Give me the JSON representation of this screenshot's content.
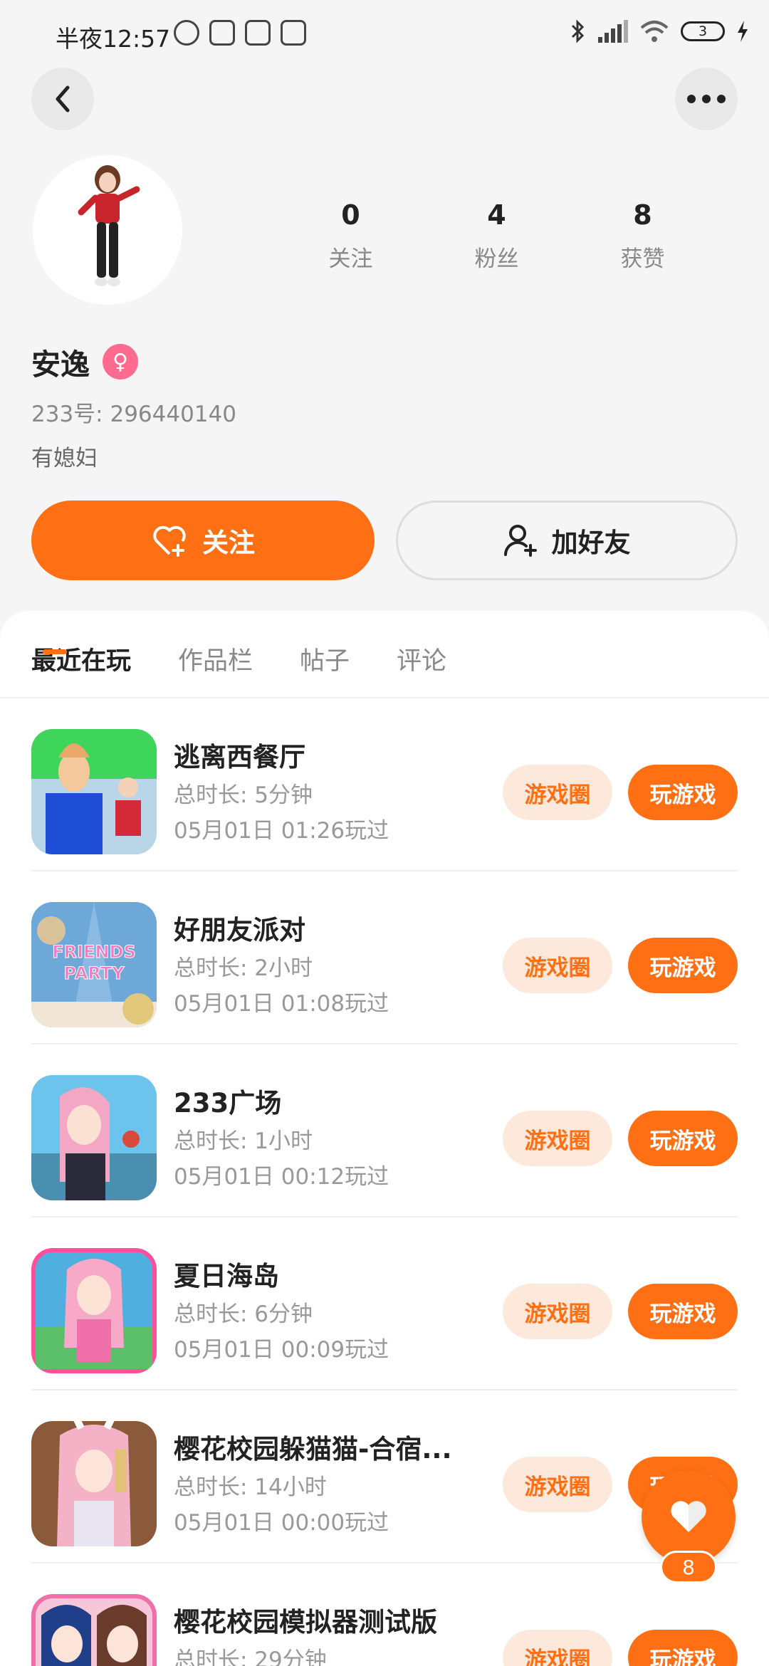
{
  "status_bar": {
    "time": "半夜12:57",
    "battery": "3"
  },
  "profile": {
    "stats": [
      {
        "value": "0",
        "label": "关注"
      },
      {
        "value": "4",
        "label": "粉丝"
      },
      {
        "value": "8",
        "label": "获赞"
      }
    ],
    "name": "安逸",
    "gender_symbol": "♀",
    "uid": "233号: 296440140",
    "bio": "有媳妇",
    "follow_label": "关注",
    "add_friend_label": "加好友"
  },
  "tabs": [
    "最近在玩",
    "作品栏",
    "帖子",
    "评论"
  ],
  "actions": {
    "circle_label": "游戏圈",
    "play_label": "玩游戏"
  },
  "games": [
    {
      "title": "逃离西餐厅",
      "duration": "总时长: 5分钟",
      "last_played": "05月01日 01:26玩过"
    },
    {
      "title": "好朋友派对",
      "duration": "总时长: 2小时",
      "last_played": "05月01日 01:08玩过"
    },
    {
      "title": "233广场",
      "duration": "总时长: 1小时",
      "last_played": "05月01日 00:12玩过"
    },
    {
      "title": "夏日海岛",
      "duration": "总时长: 6分钟",
      "last_played": "05月01日 00:09玩过"
    },
    {
      "title": "樱花校园躲猫猫-合宿...",
      "duration": "总时长: 14小时",
      "last_played": "05月01日 00:00玩过"
    },
    {
      "title": "樱花校园模拟器测试版",
      "duration": "总时长: 29分钟",
      "last_played": ""
    }
  ],
  "thumb_text": {
    "friends": "FRIENDS",
    "party": "PARTY"
  },
  "like_count": "8",
  "colors": {
    "accent": "#ff6f14",
    "accent_light": "#fde9dc",
    "background": "#f5f5f5"
  }
}
